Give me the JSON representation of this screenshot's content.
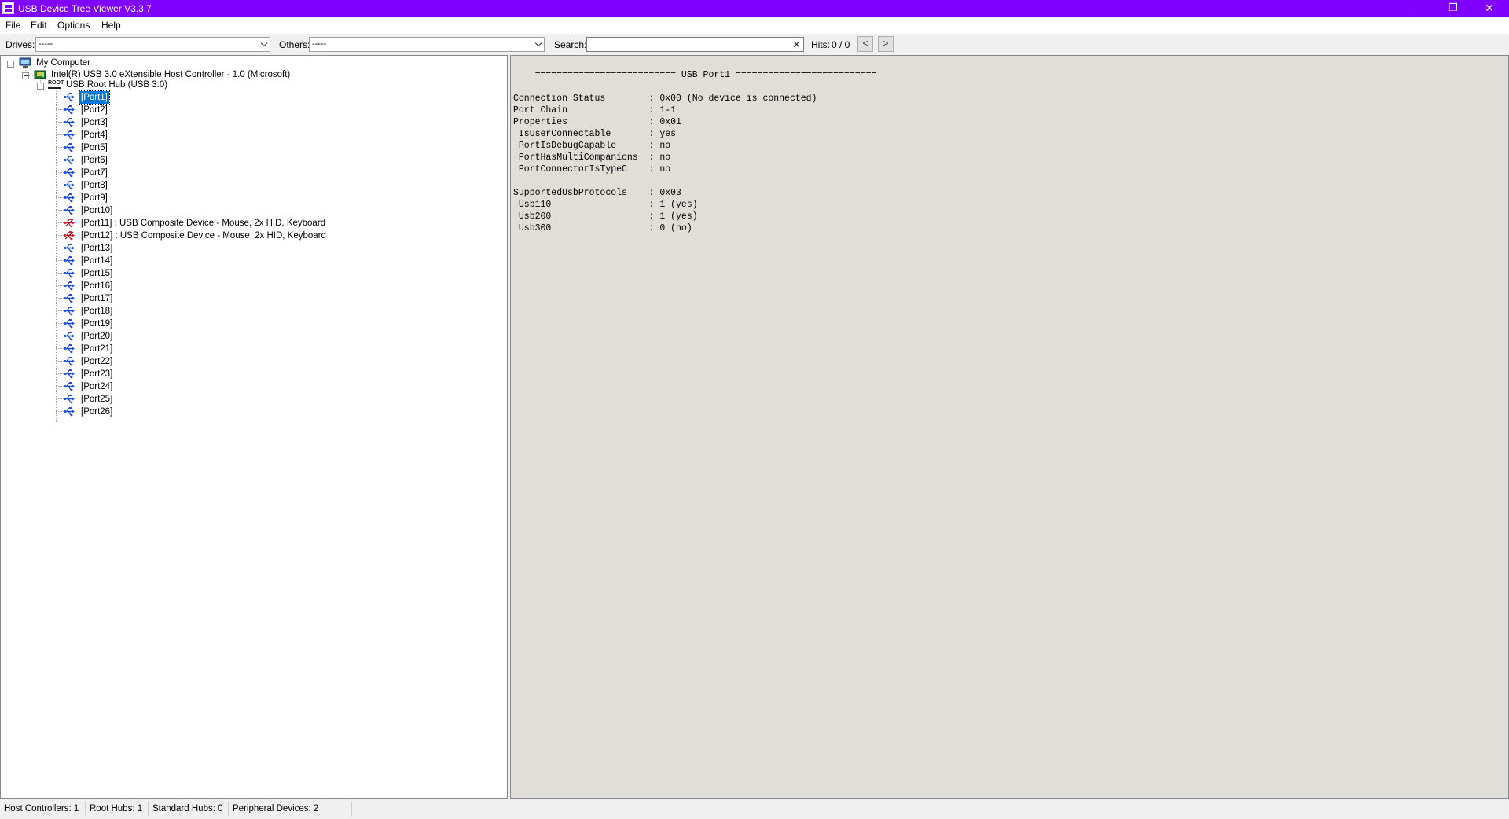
{
  "window": {
    "title": "USB Device Tree Viewer V3.3.7",
    "controls": {
      "minimize": "—",
      "restore": "❐",
      "close": "✕"
    }
  },
  "menu": [
    "File",
    "Edit",
    "Options",
    "Help"
  ],
  "toolbar": {
    "drives_label": "Drives:",
    "drives_value": "-----",
    "others_label": "Others:",
    "others_value": "-----",
    "search_label": "Search:",
    "search_value": "",
    "hits_label": "Hits:",
    "hits_value": "0 / 0",
    "prev": "<",
    "next": ">"
  },
  "tree": {
    "root": "My Computer",
    "controller": "Intel(R) USB 3.0 eXtensible Host Controller - 1.0 (Microsoft)",
    "hub_icon_text": "ROOT",
    "hub": "USB Root Hub (USB 3.0)",
    "selected_port": 0,
    "ports": [
      {
        "label": "[Port1]",
        "connected": false
      },
      {
        "label": "[Port2]",
        "connected": false
      },
      {
        "label": "[Port3]",
        "connected": false
      },
      {
        "label": "[Port4]",
        "connected": false
      },
      {
        "label": "[Port5]",
        "connected": false
      },
      {
        "label": "[Port6]",
        "connected": false
      },
      {
        "label": "[Port7]",
        "connected": false
      },
      {
        "label": "[Port8]",
        "connected": false
      },
      {
        "label": "[Port9]",
        "connected": false
      },
      {
        "label": "[Port10]",
        "connected": false
      },
      {
        "label": "[Port11] : USB Composite Device - Mouse, 2x HID, Keyboard",
        "connected": true
      },
      {
        "label": "[Port12] : USB Composite Device - Mouse, 2x HID, Keyboard",
        "connected": true
      },
      {
        "label": "[Port13]",
        "connected": false
      },
      {
        "label": "[Port14]",
        "connected": false
      },
      {
        "label": "[Port15]",
        "connected": false
      },
      {
        "label": "[Port16]",
        "connected": false
      },
      {
        "label": "[Port17]",
        "connected": false
      },
      {
        "label": "[Port18]",
        "connected": false
      },
      {
        "label": "[Port19]",
        "connected": false
      },
      {
        "label": "[Port20]",
        "connected": false
      },
      {
        "label": "[Port21]",
        "connected": false
      },
      {
        "label": "[Port22]",
        "connected": false
      },
      {
        "label": "[Port23]",
        "connected": false
      },
      {
        "label": "[Port24]",
        "connected": false
      },
      {
        "label": "[Port25]",
        "connected": false
      },
      {
        "label": "[Port26]",
        "connected": false
      }
    ]
  },
  "detail": {
    "lines": [
      "    ========================== USB Port1 ==========================",
      "",
      "Connection Status        : 0x00 (No device is connected)",
      "Port Chain               : 1-1",
      "Properties               : 0x01",
      " IsUserConnectable       : yes",
      " PortIsDebugCapable      : no",
      " PortHasMultiCompanions  : no",
      " PortConnectorIsTypeC    : no",
      "",
      "SupportedUsbProtocols    : 0x03",
      " Usb110                  : 1 (yes)",
      " Usb200                  : 1 (yes)",
      " Usb300                  : 0 (no)"
    ]
  },
  "status": {
    "host_controllers": "Host Controllers: 1",
    "root_hubs": "Root Hubs: 1",
    "standard_hubs": "Standard Hubs: 0",
    "peripheral_devices": "Peripheral Devices: 2"
  },
  "colors": {
    "titlebar": "#8000ff",
    "selection": "#0078d7",
    "usb_icon": "#1f4fd8",
    "usb_connected_icon": "#e0203a",
    "detail_bg": "#e1ded8"
  }
}
